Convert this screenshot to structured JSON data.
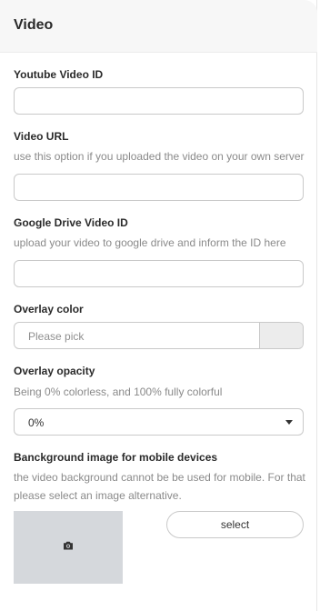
{
  "header": {
    "title": "Video"
  },
  "youtube": {
    "label": "Youtube Video ID",
    "value": ""
  },
  "video_url": {
    "label": "Video URL",
    "help": "use this option if you uploaded the video on your own server",
    "value": ""
  },
  "google_drive": {
    "label": "Google Drive Video ID",
    "help": "upload your video to google drive and inform the ID here",
    "value": ""
  },
  "overlay_color": {
    "label": "Overlay color",
    "placeholder": "Please pick",
    "swatch_color": "#ececec"
  },
  "overlay_opacity": {
    "label": "Overlay opacity",
    "help": "Being 0% colorless, and 100% fully colorful",
    "selected": "0%"
  },
  "background_image": {
    "label": "Banckground image for mobile devices",
    "help": "the video background cannot be be used for mobile. For that please select an image alternative.",
    "icon": "camera-icon",
    "button_label": "select"
  }
}
